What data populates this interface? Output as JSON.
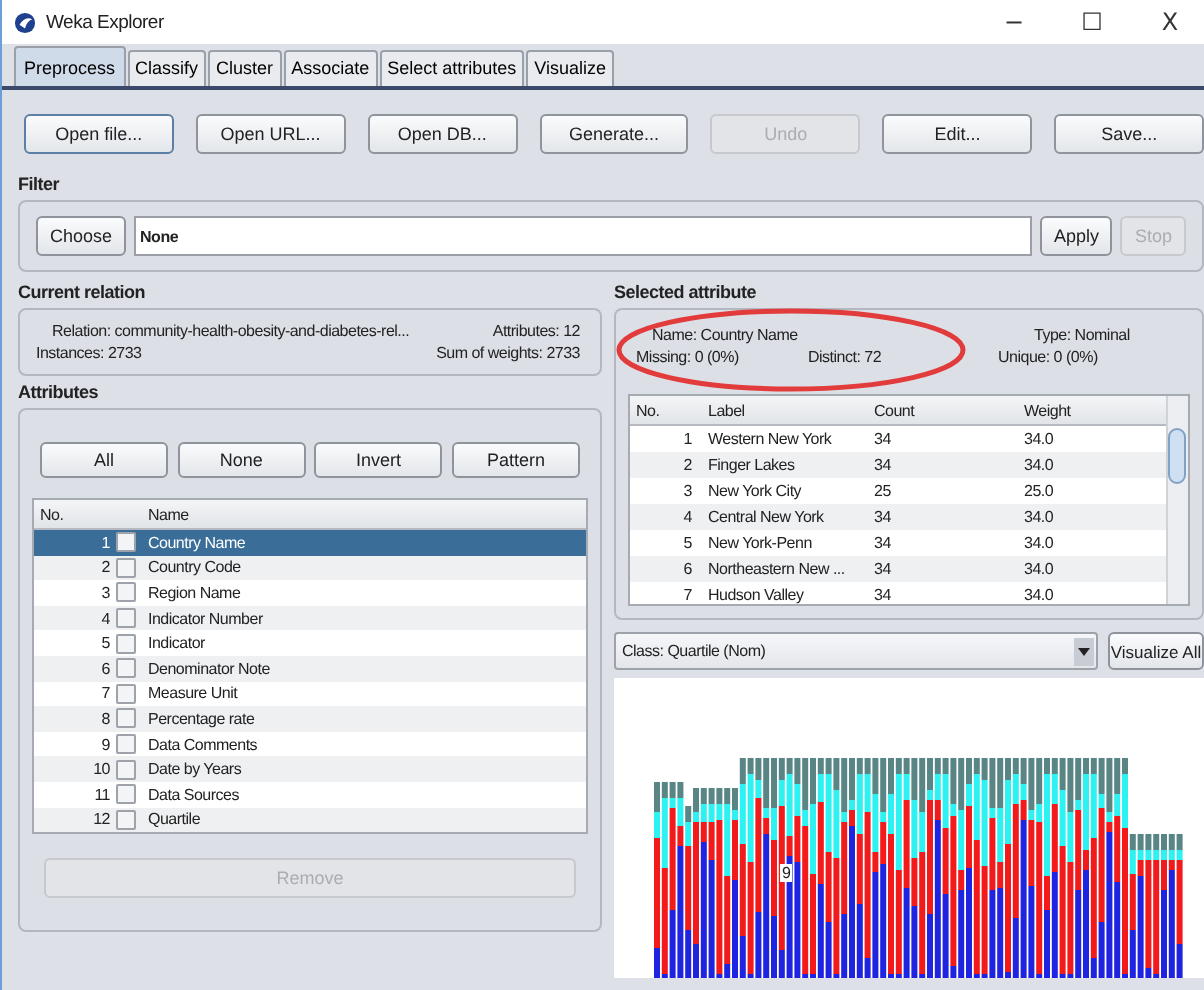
{
  "window": {
    "title": "Weka Explorer",
    "controls": [
      "−",
      "☐",
      "X"
    ]
  },
  "tabs": [
    {
      "label": "Preprocess",
      "selected": true
    },
    {
      "label": "Classify",
      "selected": false
    },
    {
      "label": "Cluster",
      "selected": false
    },
    {
      "label": "Associate",
      "selected": false
    },
    {
      "label": "Select attributes",
      "selected": false
    },
    {
      "label": "Visualize",
      "selected": false
    }
  ],
  "toolbar": [
    {
      "label": "Open file...",
      "disabled": false
    },
    {
      "label": "Open URL...",
      "disabled": false
    },
    {
      "label": "Open DB...",
      "disabled": false
    },
    {
      "label": "Generate...",
      "disabled": false
    },
    {
      "label": "Undo",
      "disabled": true
    },
    {
      "label": "Edit...",
      "disabled": false
    },
    {
      "label": "Save...",
      "disabled": false
    }
  ],
  "filter": {
    "heading": "Filter",
    "choose": "Choose",
    "value": "None",
    "apply": {
      "label": "Apply",
      "disabled": false
    },
    "stop": {
      "label": "Stop",
      "disabled": true
    }
  },
  "current_relation": {
    "heading": "Current relation",
    "relation": "Relation: community-health-obesity-and-diabetes-rel...",
    "attributes": "Attributes: 12",
    "instances": "Instances: 2733",
    "sum_of_weights": "Sum of weights: 2733"
  },
  "attributes": {
    "heading": "Attributes",
    "buttons": [
      "All",
      "None",
      "Invert",
      "Pattern"
    ],
    "columns": [
      "No.",
      "Name"
    ],
    "rows": [
      {
        "no": "1",
        "name": "Country Name",
        "selected": true,
        "checked": false
      },
      {
        "no": "2",
        "name": "Country Code",
        "selected": false,
        "checked": false
      },
      {
        "no": "3",
        "name": "Region Name",
        "selected": false,
        "checked": false
      },
      {
        "no": "4",
        "name": "Indicator Number",
        "selected": false,
        "checked": false
      },
      {
        "no": "5",
        "name": "Indicator",
        "selected": false,
        "checked": false
      },
      {
        "no": "6",
        "name": "Denominator Note",
        "selected": false,
        "checked": false
      },
      {
        "no": "7",
        "name": "Measure Unit",
        "selected": false,
        "checked": false
      },
      {
        "no": "8",
        "name": "Percentage rate",
        "selected": false,
        "checked": false
      },
      {
        "no": "9",
        "name": "Data Comments",
        "selected": false,
        "checked": false
      },
      {
        "no": "10",
        "name": "Date by Years",
        "selected": false,
        "checked": false
      },
      {
        "no": "11",
        "name": "Data Sources",
        "selected": false,
        "checked": false
      },
      {
        "no": "12",
        "name": "Quartile",
        "selected": false,
        "checked": false
      }
    ],
    "remove": {
      "label": "Remove",
      "disabled": true
    }
  },
  "selected_attribute": {
    "heading": "Selected attribute",
    "name": "Name: Country Name",
    "type": "Type: Nominal",
    "missing": "Missing: 0 (0%)",
    "distinct": "Distinct: 72",
    "unique": "Unique: 0 (0%)",
    "columns": [
      "No.",
      "Label",
      "Count",
      "Weight"
    ],
    "rows": [
      {
        "no": "1",
        "label": "Western New York",
        "count": "34",
        "weight": "34.0"
      },
      {
        "no": "2",
        "label": "Finger Lakes",
        "count": "34",
        "weight": "34.0"
      },
      {
        "no": "3",
        "label": "New York City",
        "count": "25",
        "weight": "25.0"
      },
      {
        "no": "4",
        "label": "Central New York",
        "count": "34",
        "weight": "34.0"
      },
      {
        "no": "5",
        "label": "New York-Penn",
        "count": "34",
        "weight": "34.0"
      },
      {
        "no": "6",
        "label": "Northeastern New ...",
        "count": "34",
        "weight": "34.0"
      },
      {
        "no": "7",
        "label": "Hudson Valley",
        "count": "34",
        "weight": "34.0"
      }
    ]
  },
  "class_selector": {
    "value": "Class: Quartile (Nom)",
    "visualize_all": "Visualize All"
  },
  "histogram": {
    "bar_label": "9"
  }
}
